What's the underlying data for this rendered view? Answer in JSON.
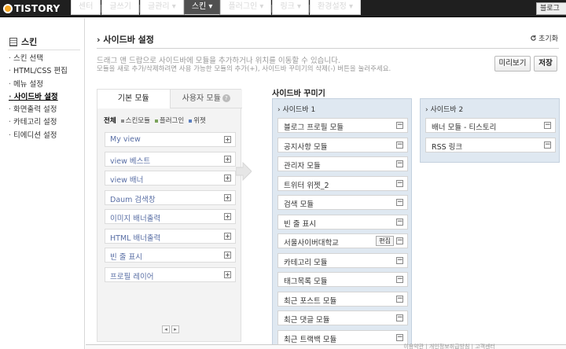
{
  "topbar": {
    "logo_text": "TISTORY",
    "nav": [
      {
        "label": "센터",
        "active": false
      },
      {
        "label": "글쓰기",
        "active": false
      },
      {
        "label": "글관리 ▾",
        "active": false
      },
      {
        "label": "스킨 ▾",
        "active": true
      },
      {
        "label": "플러그인 ▾",
        "active": false
      },
      {
        "label": "링크 ▾",
        "active": false
      },
      {
        "label": "환경설정 ▾",
        "active": false
      }
    ],
    "blog_button": "블로그"
  },
  "sidebar": {
    "title": "스킨",
    "items": [
      {
        "label": "스킨 선택",
        "active": false
      },
      {
        "label": "HTML/CSS 편집",
        "active": false
      },
      {
        "label": "메뉴 설정",
        "active": false
      },
      {
        "label": "사이드바 설정",
        "active": true
      },
      {
        "label": "화면출력 설정",
        "active": false
      },
      {
        "label": "카테고리 설정",
        "active": false
      },
      {
        "label": "티에디션 설정",
        "active": false
      }
    ]
  },
  "main": {
    "title": "› 사이드바 설정",
    "reset_label": "초기화",
    "description_1": "드래그 앤 드랍으로 사이드바에 모듈을 추가하거나 위치를 이동할 수 있습니다.",
    "description_2": "모듈을 새로 추가/삭제하려면 사용 가능한 모듈의 추가(+), 사이드바 꾸미기의 삭제(-) 버튼을 눌러주세요.",
    "preview_button": "미리보기",
    "save_button": "저장"
  },
  "module_panel": {
    "tabs": [
      {
        "label": "기본 모듈",
        "active": true
      },
      {
        "label": "사용자 모듈",
        "active": false
      }
    ],
    "help_icon_glyph": "?",
    "filters": [
      {
        "label": "전체",
        "active": true
      },
      {
        "label": "스킨모듈",
        "active": false,
        "color": "#8a8a8a"
      },
      {
        "label": "플러그인",
        "active": false,
        "color": "#7aa35a"
      },
      {
        "label": "위젯",
        "active": false,
        "color": "#5a7fc0"
      }
    ],
    "modules": [
      "My view",
      "view 베스트",
      "view 배너",
      "Daum 검색창",
      "이미지 배너출력",
      "HTML 배너출력",
      "빈 줄 표시",
      "프로필 레이어"
    ],
    "add_glyph": "+",
    "pager": [
      "◂",
      "▸"
    ]
  },
  "decorate": {
    "title": "사이드바 꾸미기",
    "sidebar1": {
      "title": "사이드바 1",
      "items": [
        {
          "label": "블로그 프로필 모듈",
          "editable": false
        },
        {
          "label": "공지사항 모듈",
          "editable": false
        },
        {
          "label": "관리자 모듈",
          "editable": false
        },
        {
          "label": "트위터 위젯_2",
          "editable": false
        },
        {
          "label": "검색 모듈",
          "editable": false
        },
        {
          "label": "빈 줄 표시",
          "editable": false
        },
        {
          "label": "서울사이버대학교",
          "editable": true
        },
        {
          "label": "카테고리 모듈",
          "editable": false
        },
        {
          "label": "태그목록 모듈",
          "editable": false
        },
        {
          "label": "최근 포스트 모듈",
          "editable": false
        },
        {
          "label": "최근 댓글 모듈",
          "editable": false
        },
        {
          "label": "최근 트랙백 모듈",
          "editable": false
        }
      ]
    },
    "sidebar2": {
      "title": "사이드바 2",
      "items": [
        {
          "label": "배너 모듈 - 티스토리",
          "editable": false
        },
        {
          "label": "RSS 링크",
          "editable": false
        }
      ]
    },
    "edit_label": "편집",
    "remove_glyph": "−"
  },
  "footer": {
    "text": "이용약관 | 개인정보취급방침 | 고객센터"
  },
  "colors": {
    "topbar_bg": "#1f1f1f",
    "sidebar_column_bg": "#dfe8f1",
    "module_link": "#5a6fa5"
  }
}
